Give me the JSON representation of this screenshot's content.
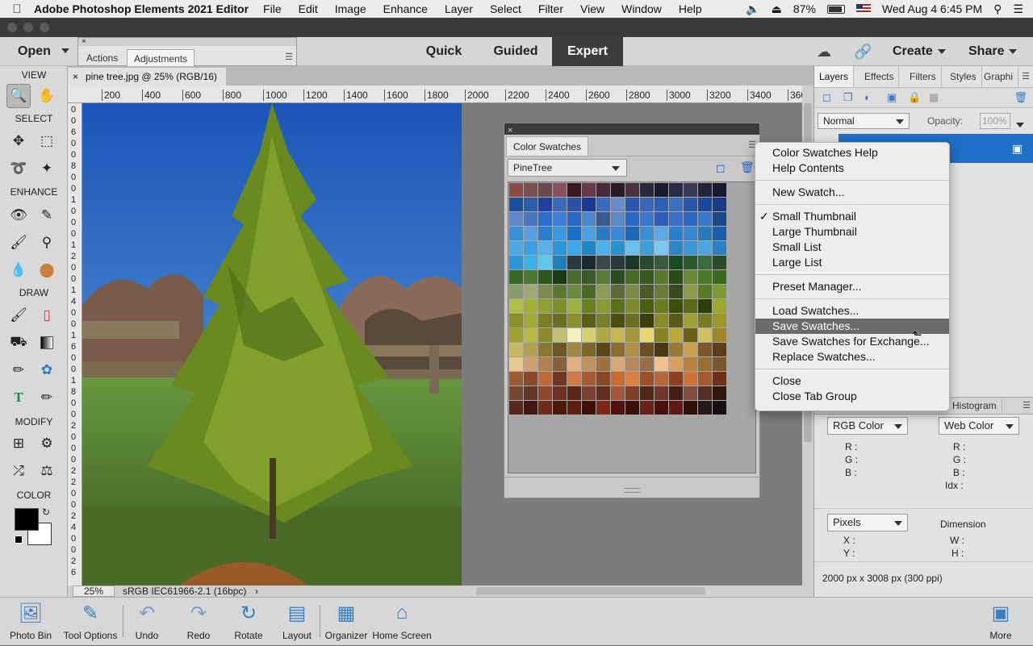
{
  "menubar": {
    "app_name": "Adobe Photoshop Elements 2021 Editor",
    "items": [
      "File",
      "Edit",
      "Image",
      "Enhance",
      "Layer",
      "Select",
      "Filter",
      "View",
      "Window",
      "Help"
    ],
    "battery": "87%",
    "datetime": "Wed Aug 4  6:45 PM"
  },
  "topbar": {
    "open_label": "Open",
    "modes": [
      "Quick",
      "Guided",
      "Expert"
    ],
    "active_mode": "Expert",
    "create_label": "Create",
    "share_label": "Share"
  },
  "actions_panel": {
    "tabs": [
      "Actions",
      "Adjustments"
    ],
    "active_tab": "Adjustments"
  },
  "toolbox": {
    "sections": [
      "VIEW",
      "SELECT",
      "ENHANCE",
      "DRAW",
      "MODIFY",
      "COLOR"
    ],
    "foreground_color": "#000000",
    "background_color": "#ffffff"
  },
  "document": {
    "tab_title": "pine tree.jpg @ 25% (RGB/16)",
    "ruler_labels": [
      "200",
      "400",
      "600",
      "800",
      "1000",
      "1200",
      "1400",
      "1600",
      "1800",
      "2000",
      "2200",
      "2400",
      "2600",
      "2800",
      "3000",
      "3200",
      "3400",
      "360"
    ],
    "vruler_digits": [
      "0",
      "0",
      "6",
      "0",
      "0",
      "8",
      "0",
      "0",
      "1",
      "0",
      "0",
      "0",
      "1",
      "2",
      "0",
      "0",
      "1",
      "4",
      "0",
      "0",
      "1",
      "6",
      "0",
      "0",
      "1",
      "8",
      "0",
      "0",
      "2",
      "0",
      "0",
      "0",
      "2",
      "2",
      "0",
      "0",
      "2",
      "4",
      "0",
      "0",
      "2",
      "6"
    ],
    "zoom": "25%",
    "color_profile": "sRGB IEC61966-2.1 (16bpc)"
  },
  "swatches_panel": {
    "tab": "Color Swatches",
    "preset": "PineTree",
    "rows": [
      [
        "#8c4a4a",
        "#7a5050",
        "#6a4a50",
        "#8a5060",
        "#3a1a22",
        "#6a3a4a",
        "#4a2838",
        "#2a1a28",
        "#4a3040",
        "#2a2a3a",
        "#1a1a30",
        "#2a2a44",
        "#3a3a58",
        "#222238",
        "#181830"
      ],
      [
        "#1a4fa0",
        "#2a5fa8",
        "#2040a0",
        "#3a6ab8",
        "#2a50a8",
        "#1a3a98",
        "#3a6ac0",
        "#6a8ac8",
        "#2a58b0",
        "#3a68b8",
        "#2a60b8",
        "#3a70c0",
        "#2a58a8",
        "#1a48a0",
        "#1a3a88"
      ],
      [
        "#5a88c8",
        "#4a78c0",
        "#2a70d0",
        "#3a80d8",
        "#2a68c8",
        "#4a88d0",
        "#3a5a90",
        "#5a8ac8",
        "#2a68c8",
        "#3a78d0",
        "#2a60b8",
        "#3a70c8",
        "#2a68c0",
        "#3a78c8",
        "#1a4888"
      ],
      [
        "#3a90d8",
        "#5aa0e0",
        "#2a80d0",
        "#3a98e0",
        "#1a70c8",
        "#4aa0e0",
        "#2a78c8",
        "#3a88d8",
        "#1a68b8",
        "#3a90d8",
        "#5aa8e8",
        "#2a80d0",
        "#3a88d0",
        "#2a78c0",
        "#1a60a8"
      ],
      [
        "#4aa8e8",
        "#3aa0e0",
        "#5ab0e8",
        "#2a98d8",
        "#3aa8e8",
        "#1a88c8",
        "#4ab0e8",
        "#2a90d0",
        "#6ac0f0",
        "#3aa0d8",
        "#7ac8f0",
        "#2a88c8",
        "#3a98d8",
        "#4aa8e0",
        "#2a80c0"
      ],
      [
        "#2a98d8",
        "#3ab0e8",
        "#5ac8f0",
        "#1a80c0",
        "#2a3a40",
        "#1a2a30",
        "#3a4a48",
        "#2a3a38",
        "#1a3a28",
        "#2a4a30",
        "#3a5a40",
        "#1a4a20",
        "#2a5a30",
        "#3a6a40",
        "#2a4a28"
      ],
      [
        "#3a6a28",
        "#4a7a30",
        "#2a5a20",
        "#1a3a18",
        "#4a6a30",
        "#3a5a28",
        "#5a7a38",
        "#2a4a20",
        "#4a6a28",
        "#3a5a20",
        "#5a7a30",
        "#2a4a18",
        "#6a8a38",
        "#4a7a28",
        "#3a6a20"
      ],
      [
        "#8a9a68",
        "#a0a878",
        "#7a8a50",
        "#5a7a30",
        "#6a8a40",
        "#4a6a28",
        "#8a9a58",
        "#5a6a38",
        "#7a8a48",
        "#4a5a28",
        "#6a7a38",
        "#3a4a20",
        "#8a9a48",
        "#5a7a28",
        "#7a9a38"
      ],
      [
        "#b0c048",
        "#a0b038",
        "#90a030",
        "#7a9028",
        "#a0b040",
        "#6a8020",
        "#8a9a30",
        "#5a7018",
        "#7a8a28",
        "#4a6010",
        "#6a7a20",
        "#3a5008",
        "#5a6a18",
        "#2a4008",
        "#9aa830"
      ],
      [
        "#8a9028",
        "#a0a838",
        "#7a8020",
        "#6a7020",
        "#8a9030",
        "#5a6018",
        "#7a8028",
        "#4a5010",
        "#6a7020",
        "#3a4008",
        "#8a8a28",
        "#5a5a18",
        "#a0a030",
        "#7a7a20",
        "#9a9828"
      ],
      [
        "#a0a030",
        "#b8b840",
        "#8a8a28",
        "#c0c070",
        "#f0f0c0",
        "#d8d070",
        "#b0a840",
        "#c8b850",
        "#a09838",
        "#e8d870",
        "#8a8020",
        "#b8a838",
        "#6a6018",
        "#d0c060",
        "#9a8828"
      ],
      [
        "#c8b860",
        "#b0a050",
        "#8a7830",
        "#6a5820",
        "#a08840",
        "#7a6828",
        "#5a4818",
        "#8a7030",
        "#b09048",
        "#6a5020",
        "#4a3810",
        "#9a7838",
        "#c8a050",
        "#7a5828",
        "#5a4018"
      ],
      [
        "#e8c890",
        "#d0a070",
        "#b08050",
        "#8a6038",
        "#e0b080",
        "#c09060",
        "#a07040",
        "#d8a878",
        "#b88858",
        "#987048",
        "#f0c090",
        "#d8a060",
        "#b88040",
        "#987030",
        "#785828"
      ],
      [
        "#a05a30",
        "#8a4a28",
        "#c06a38",
        "#703820",
        "#d07840",
        "#a85a30",
        "#884828",
        "#c86a30",
        "#e08040",
        "#a05028",
        "#b86838",
        "#904020",
        "#d07038",
        "#a85830",
        "#703018"
      ],
      [
        "#7a4830",
        "#603828",
        "#904830",
        "#703020",
        "#5a2818",
        "#804030",
        "#603020",
        "#a05838",
        "#804028",
        "#502818",
        "#703828",
        "#402018",
        "#805040",
        "#503028",
        "#301810"
      ],
      [
        "#5a2818",
        "#401810",
        "#702818",
        "#501808",
        "#602010",
        "#401008",
        "#802818",
        "#501010",
        "#381008",
        "#682018",
        "#481010",
        "#601818",
        "#301008",
        "#281818",
        "#181010"
      ]
    ]
  },
  "context_menu": {
    "items": [
      {
        "label": "Color Swatches Help"
      },
      {
        "label": "Help Contents"
      },
      {
        "sep": true
      },
      {
        "label": "New Swatch..."
      },
      {
        "sep": true
      },
      {
        "label": "Small Thumbnail",
        "checked": true
      },
      {
        "label": "Large Thumbnail"
      },
      {
        "label": "Small List"
      },
      {
        "label": "Large List"
      },
      {
        "sep": true
      },
      {
        "label": "Preset Manager..."
      },
      {
        "sep": true
      },
      {
        "label": "Load Swatches..."
      },
      {
        "label": "Save Swatches...",
        "highlighted": true
      },
      {
        "label": "Save Swatches for Exchange..."
      },
      {
        "label": "Replace Swatches..."
      },
      {
        "sep": true
      },
      {
        "label": "Close"
      },
      {
        "label": "Close Tab Group"
      }
    ]
  },
  "right_panel": {
    "tabs": [
      "Layers",
      "Effects",
      "Filters",
      "Styles",
      "Graphi"
    ],
    "active_tab": "Layers",
    "blend_mode": "Normal",
    "opacity_label": "Opacity:",
    "opacity_value": "100%",
    "info_tab": "Histogram",
    "left_mode": "RGB Color",
    "right_mode": "Web Color",
    "rgb_labels": [
      "R :",
      "G :",
      "B :"
    ],
    "web_labels": [
      "R :",
      "G :",
      "B :",
      "Idx :"
    ],
    "unit": "Pixels",
    "dimension_label": "Dimension",
    "xy_labels": [
      "X :",
      "Y :"
    ],
    "wh_labels": [
      "W :",
      "H :"
    ],
    "doc_size": "2000 px x 3008 px (300 ppi)"
  },
  "bottombar": {
    "items": [
      "Photo Bin",
      "Tool Options",
      "Undo",
      "Redo",
      "Rotate",
      "Layout",
      "Organizer",
      "Home Screen"
    ],
    "more": "More"
  }
}
